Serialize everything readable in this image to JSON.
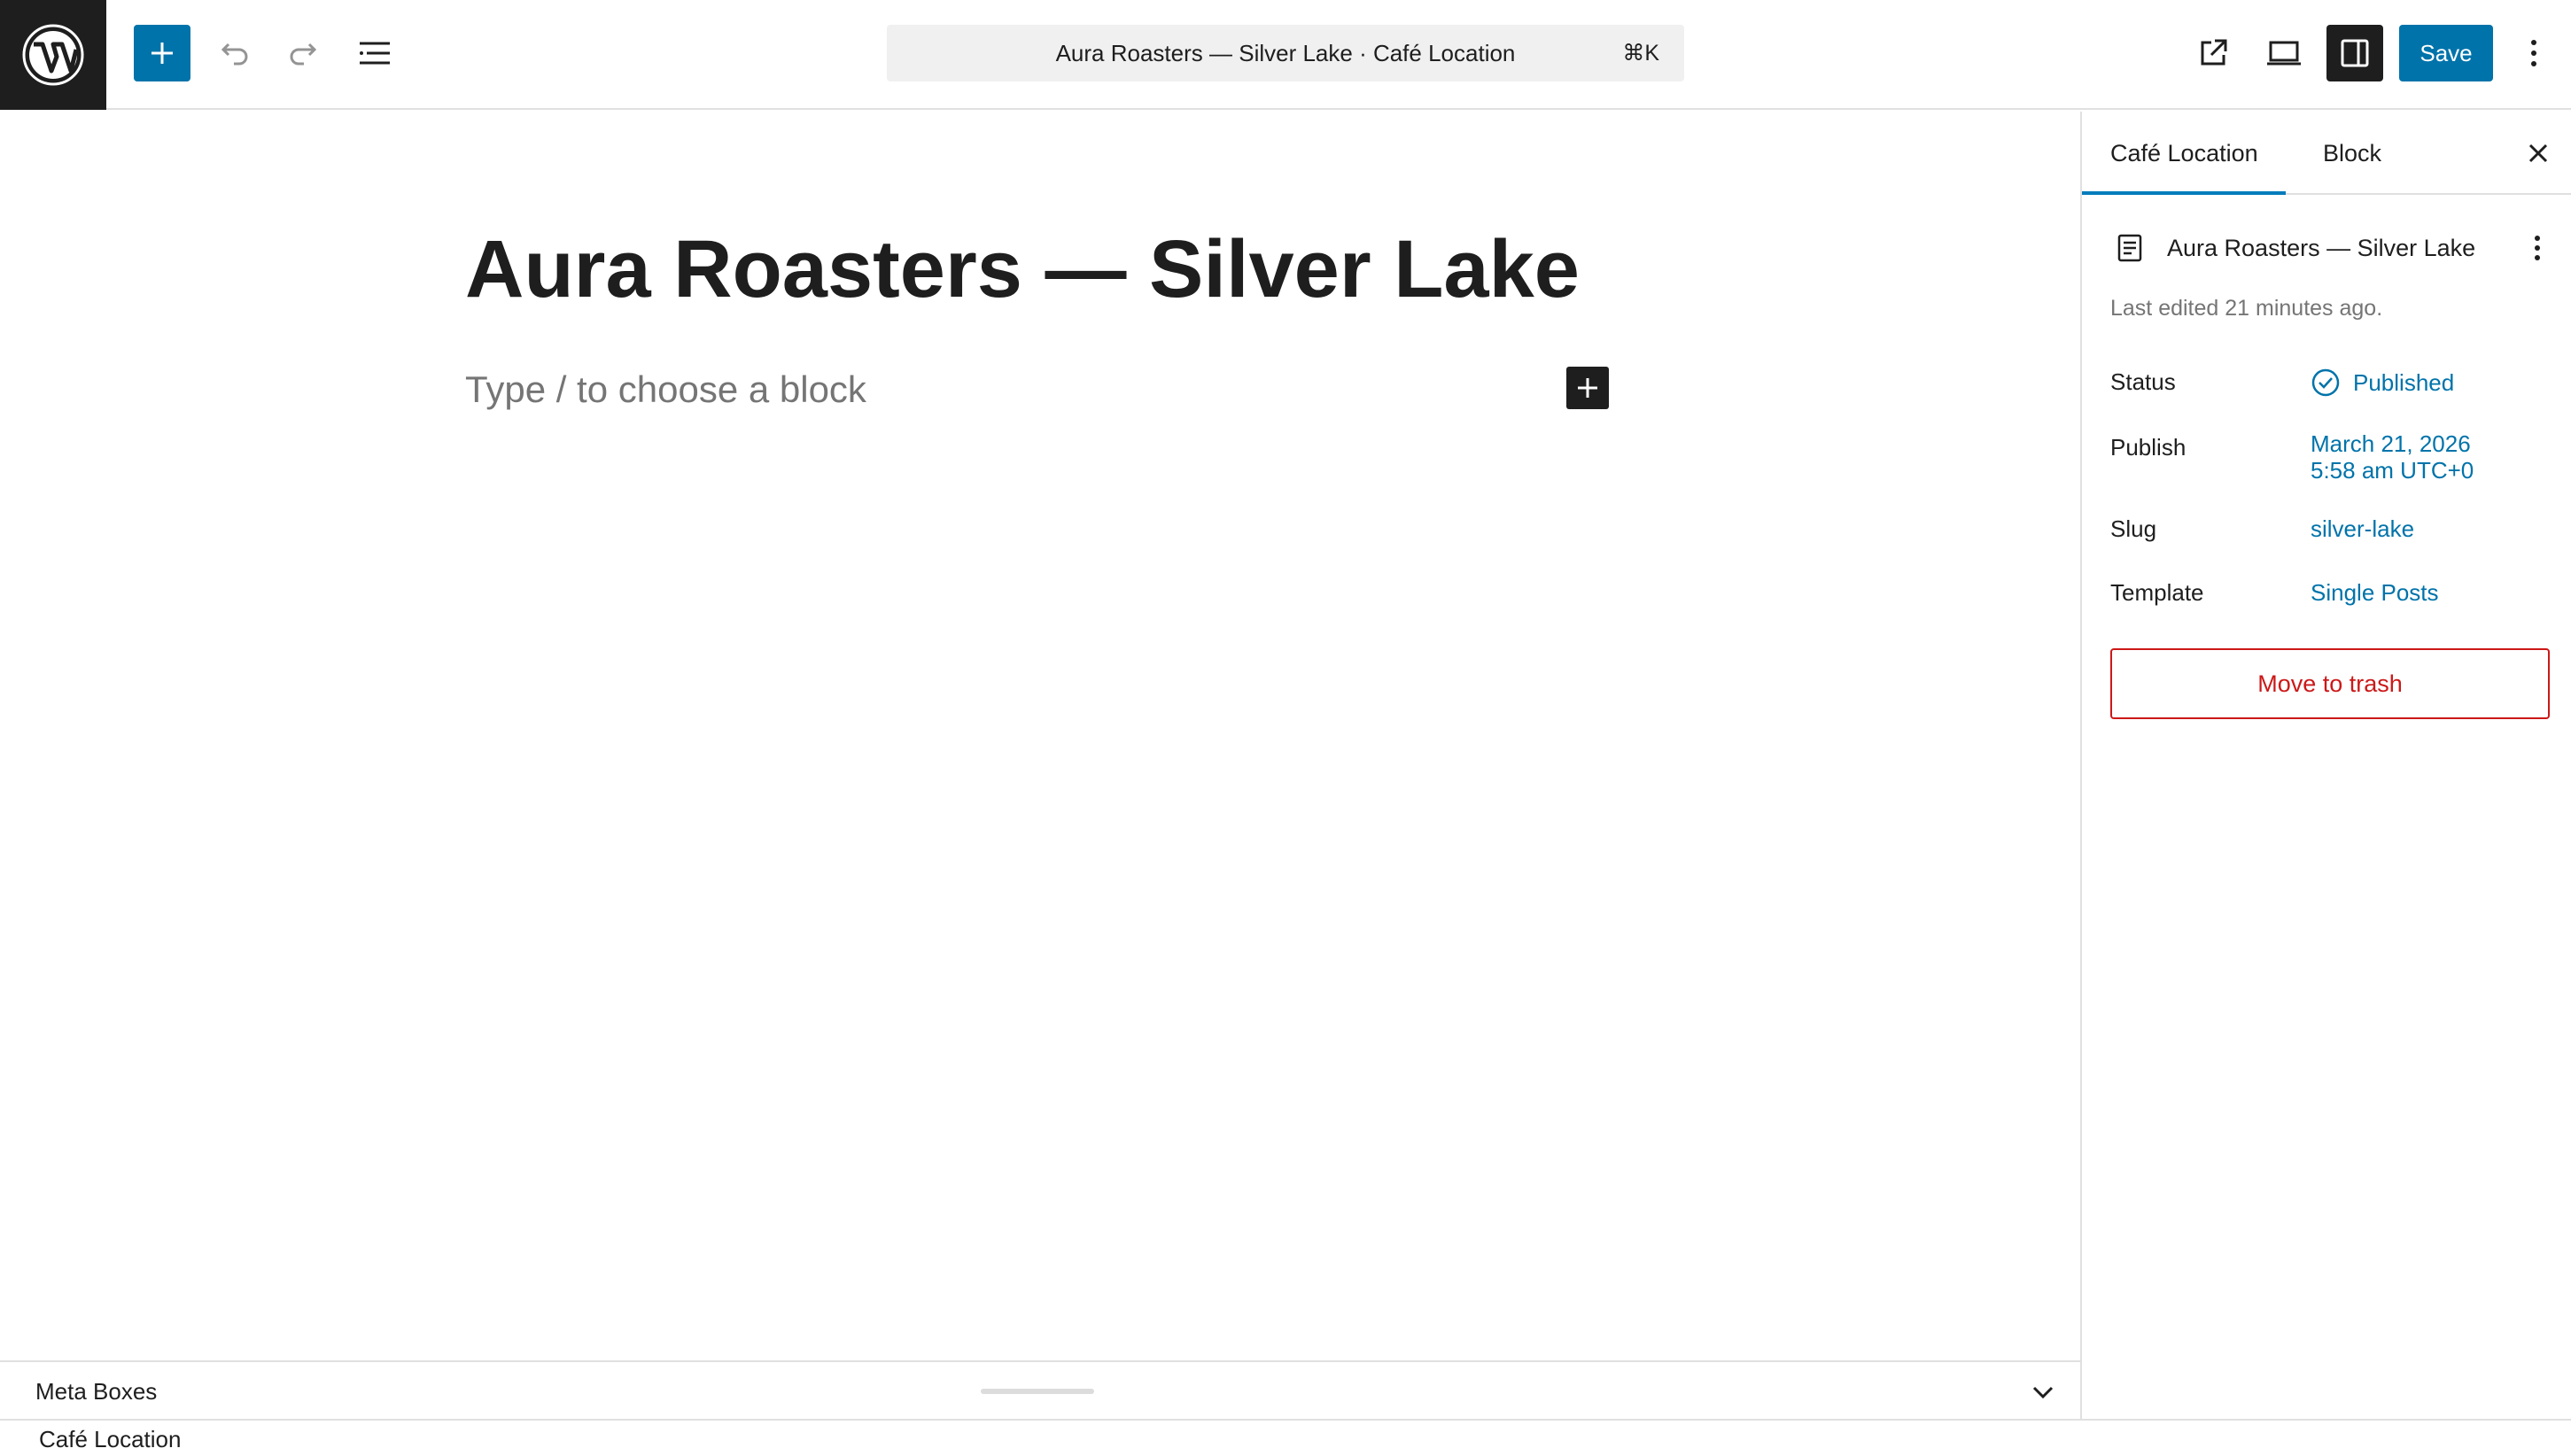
{
  "header": {
    "command_title": "Aura Roasters — Silver Lake · Café Location",
    "command_shortcut": "⌘K",
    "save_label": "Save"
  },
  "editor": {
    "post_title": "Aura Roasters — Silver Lake",
    "block_placeholder": "Type / to choose a block"
  },
  "sidebar": {
    "tabs": [
      {
        "label": "Café Location"
      },
      {
        "label": "Block"
      }
    ],
    "document_title": "Aura Roasters — Silver Lake",
    "last_edited": "Last edited 21 minutes ago.",
    "fields": {
      "status_label": "Status",
      "status_value": "Published",
      "publish_label": "Publish",
      "publish_date": "March 21, 2026",
      "publish_time": "5:58 am UTC+0",
      "slug_label": "Slug",
      "slug_value": "silver-lake",
      "template_label": "Template",
      "template_value": "Single Posts"
    },
    "trash_label": "Move to trash"
  },
  "meta_boxes": {
    "title": "Meta Boxes",
    "content_label": "Café Location"
  },
  "colors": {
    "accent": "#0073aa",
    "dark": "#1e1e1e",
    "destructive": "#cc1818",
    "muted": "#757575"
  }
}
